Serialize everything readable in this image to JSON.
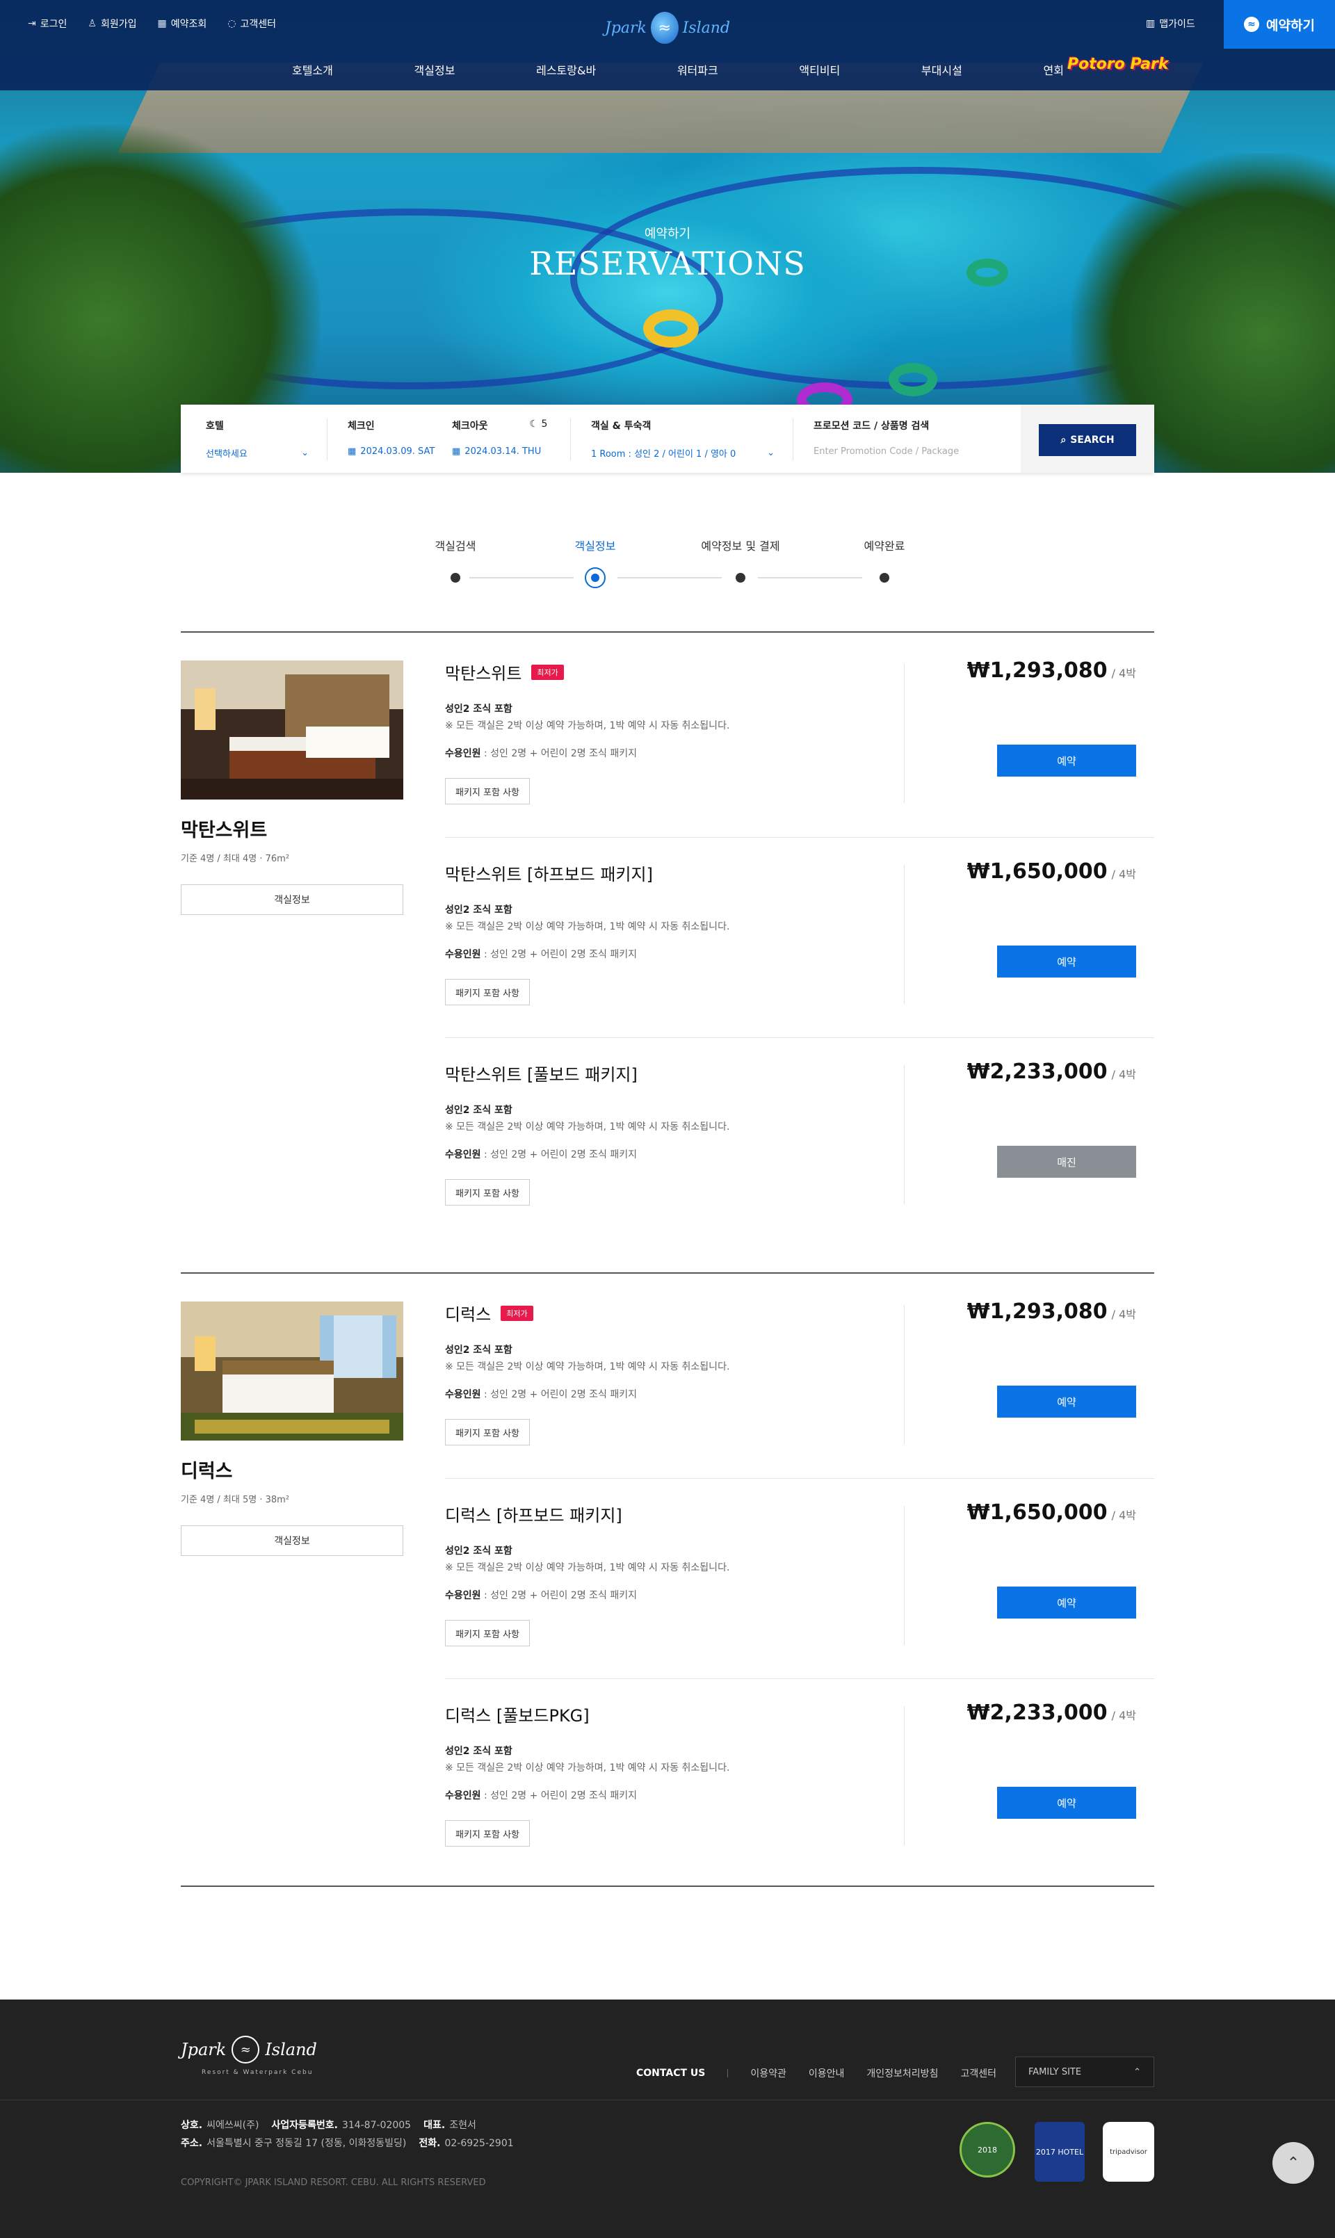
{
  "header": {
    "util": [
      {
        "icon": "login-icon",
        "label": "로그인"
      },
      {
        "icon": "user-icon",
        "label": "회원가입"
      },
      {
        "icon": "calendar-icon",
        "label": "예약조회"
      },
      {
        "icon": "chat-icon",
        "label": "고객센터"
      }
    ],
    "logo_left": "Jpark",
    "logo_right": "Island",
    "map_guide": "맵가이드",
    "book_label": "예약하기",
    "nav": [
      "호텔소개",
      "객실정보",
      "레스토랑&바",
      "워터파크",
      "액티비티",
      "부대시설",
      "연회"
    ],
    "potoro": "Potoro Park"
  },
  "hero": {
    "subtitle": "예약하기",
    "title": "RESERVATIONS"
  },
  "search": {
    "hotel_label": "호텔",
    "hotel_value": "선택하세요",
    "checkin_label": "체크인",
    "checkin_value": "2024.03.09. SAT",
    "checkout_label": "체크아웃",
    "checkout_value": "2024.03.14. THU",
    "nights": "5",
    "guests_label": "객실 & 투숙객",
    "guests_value": "1 Room : 성인 2 / 어린이 1 / 영아 0",
    "promo_label": "프로모션 코드 / 상품명 검색",
    "promo_placeholder": "Enter Promotion Code / Package",
    "search_button": "SEARCH"
  },
  "steps": [
    "객실검색",
    "객실정보",
    "예약정보 및 결제",
    "예약완료"
  ],
  "rooms": [
    {
      "name": "막탄스위트",
      "meta": "기준 4명 / 최대 4명  ·  76m²",
      "info_button": "객실정보",
      "packages": [
        {
          "title": "막탄스위트",
          "badge": "최저가",
          "line1": "성인2 조식 포함",
          "line2": "※ 모든 객실은 2박 이상 예약 가능하며, 1박 예약 시 자동 취소됩니다.",
          "line3_label": "수용인원",
          "line3": " : 성인 2명 + 어린이 2명 조식 패키지",
          "detail_button": "패키지 포함 사항",
          "price": "₩1,293,080",
          "per": "/ 4박",
          "book": "예약",
          "sold": false
        },
        {
          "title": "막탄스위트 [하프보드 패키지]",
          "badge": "",
          "line1": "성인2 조식 포함",
          "line2": "※ 모든 객실은 2박 이상 예약 가능하며, 1박 예약 시 자동 취소됩니다.",
          "line3_label": "수용인원",
          "line3": " : 성인 2명 + 어린이 2명 조식 패키지",
          "detail_button": "패키지 포함 사항",
          "price": "₩1,650,000",
          "per": "/ 4박",
          "book": "예약",
          "sold": false
        },
        {
          "title": "막탄스위트 [풀보드 패키지]",
          "badge": "",
          "line1": "성인2 조식 포함",
          "line2": "※ 모든 객실은 2박 이상 예약 가능하며, 1박 예약 시 자동 취소됩니다.",
          "line3_label": "수용인원",
          "line3": " : 성인 2명 + 어린이 2명 조식 패키지",
          "detail_button": "패키지 포함 사항",
          "price": "₩2,233,000",
          "per": "/ 4박",
          "book": "매진",
          "sold": true
        }
      ]
    },
    {
      "name": "디럭스",
      "meta": "기준 4명 / 최대 5명  ·  38m²",
      "info_button": "객실정보",
      "packages": [
        {
          "title": "디럭스",
          "badge": "최저가",
          "line1": "성인2 조식 포함",
          "line2": "※ 모든 객실은 2박 이상 예약 가능하며, 1박 예약 시 자동 취소됩니다.",
          "line3_label": "수용인원",
          "line3": " : 성인 2명 + 어린이 2명 조식 패키지",
          "detail_button": "패키지 포함 사항",
          "price": "₩1,293,080",
          "per": "/ 4박",
          "book": "예약",
          "sold": false
        },
        {
          "title": "디럭스 [하프보드 패키지]",
          "badge": "",
          "line1": "성인2 조식 포함",
          "line2": "※ 모든 객실은 2박 이상 예약 가능하며, 1박 예약 시 자동 취소됩니다.",
          "line3_label": "수용인원",
          "line3": " : 성인 2명 + 어린이 2명 조식 패키지",
          "detail_button": "패키지 포함 사항",
          "price": "₩1,650,000",
          "per": "/ 4박",
          "book": "예약",
          "sold": false
        },
        {
          "title": "디럭스 [풀보드PKG]",
          "badge": "",
          "line1": "성인2 조식 포함",
          "line2": "※ 모든 객실은 2박 이상 예약 가능하며, 1박 예약 시 자동 취소됩니다.",
          "line3_label": "수용인원",
          "line3": " : 성인 2명 + 어린이 2명 조식 패키지",
          "detail_button": "패키지 포함 사항",
          "price": "₩2,233,000",
          "per": "/ 4박",
          "book": "예약",
          "sold": false
        }
      ]
    }
  ],
  "footer": {
    "logo_left": "Jpark",
    "logo_right": "Island",
    "logo_sub": "Resort & Waterpark Cebu",
    "links": [
      "CONTACT US",
      "이용약관",
      "이용안내",
      "개인정보처리방침",
      "고객센터"
    ],
    "family_site": "FAMILY SITE",
    "company_label": "상호.",
    "company": "씨에쓰씨(주)",
    "biz_label": "사업자등록번호.",
    "biz": "314-87-02005",
    "ceo_label": "대표.",
    "ceo": "조현서",
    "addr_label": "주소.",
    "addr": "서울특별시 중구 정동길 17 (정동, 이화정동빌딩)",
    "tel_label": "전화.",
    "tel": "02-6925-2901",
    "copyright": "COPYRIGHT© JPARK ISLAND RESORT. CEBU.  ALL RIGHTS RESERVED",
    "awards": [
      "2018",
      "2017 HOTEL",
      "tripadvisor"
    ]
  },
  "colors": {
    "brand_blue": "#0a74e6",
    "navy": "#0b2f78",
    "badge_red": "#e8194b",
    "sold_gray": "#8a8f95"
  }
}
